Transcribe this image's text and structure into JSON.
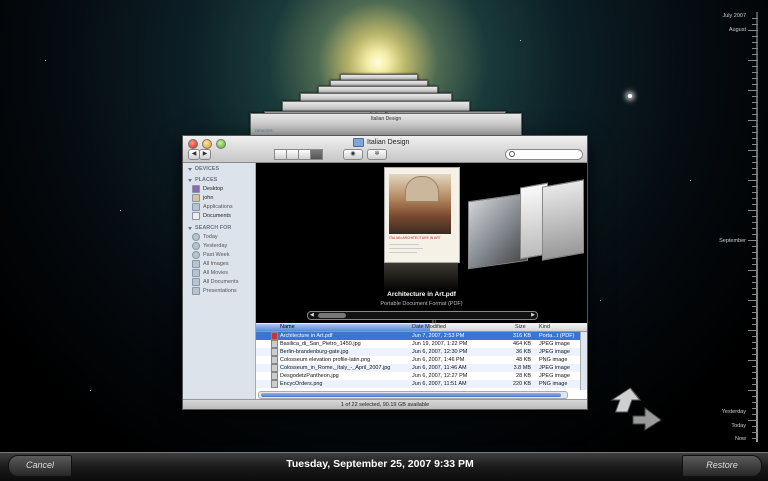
{
  "finder": {
    "title": "Italian Design",
    "nav_back": "◀",
    "nav_forward": "▶",
    "sidebar": {
      "devices_header": "DEVICES",
      "places_header": "PLACES",
      "places": [
        "Desktop",
        "john",
        "Applications",
        "Documents"
      ],
      "search_header": "SEARCH FOR",
      "search_items": [
        "Today",
        "Yesterday",
        "Past Week",
        "All Images",
        "All Movies",
        "All Documents",
        "Presentations"
      ]
    },
    "coverflow": {
      "file_name": "Architecture in Art.pdf",
      "file_kind": "Portable Document Format (PDF)",
      "doc_caption": "ITALIAN ARCHITECTURE IN ART",
      "scroll_hash": "|||"
    },
    "list": {
      "columns": {
        "name": "Name",
        "date": "Date Modified",
        "size": "Size",
        "kind": "Kind"
      },
      "rows": [
        {
          "name": "Architecture in Art.pdf",
          "date": "Jun 7, 2007, 2:53 PM",
          "size": "316 KB",
          "kind": "Porta...t (PDF)"
        },
        {
          "name": "Basilica_di_San_Pietro_1450.jpg",
          "date": "Jun 19, 2007, 1:22 PM",
          "size": "464 KB",
          "kind": "JPEG image"
        },
        {
          "name": "Berlin-brandenburg-gate.jpg",
          "date": "Jun 6, 2007, 12:30 PM",
          "size": "36 KB",
          "kind": "JPEG image"
        },
        {
          "name": "Colosseum elevation profile-latin.png",
          "date": "Jun 6, 2007, 1:46 PM",
          "size": "48 KB",
          "kind": "PNG image"
        },
        {
          "name": "Colosseum_in_Rome,_Italy_-_April_2007.jpg",
          "date": "Jun 6, 2007, 11:46 AM",
          "size": "3.8 MB",
          "kind": "JPEG image"
        },
        {
          "name": "DesgodetzPantheon.jpg",
          "date": "Jun 6, 2007, 12:27 PM",
          "size": "28 KB",
          "kind": "JPEG image"
        },
        {
          "name": "EncycOrders.png",
          "date": "Jun 6, 2007, 11:51 AM",
          "size": "220 KB",
          "kind": "PNG image"
        }
      ]
    },
    "status": "1 of 22 selected, 90.19 GB available",
    "stacked_title": "Italian Design",
    "stacked_sidebar": "DEVICES"
  },
  "timeline": {
    "labels": [
      "July 2007",
      "August",
      "September",
      "Yesterday",
      "Today",
      "Now"
    ]
  },
  "bottom_bar": {
    "cancel_label": "Cancel",
    "date_label": "Tuesday, September 25, 2007 9:33 PM",
    "restore_label": "Restore"
  },
  "colors": {
    "selection": "#3875d7",
    "sidebar": "#dde3ea",
    "nebula_core": "#fffbe0"
  }
}
